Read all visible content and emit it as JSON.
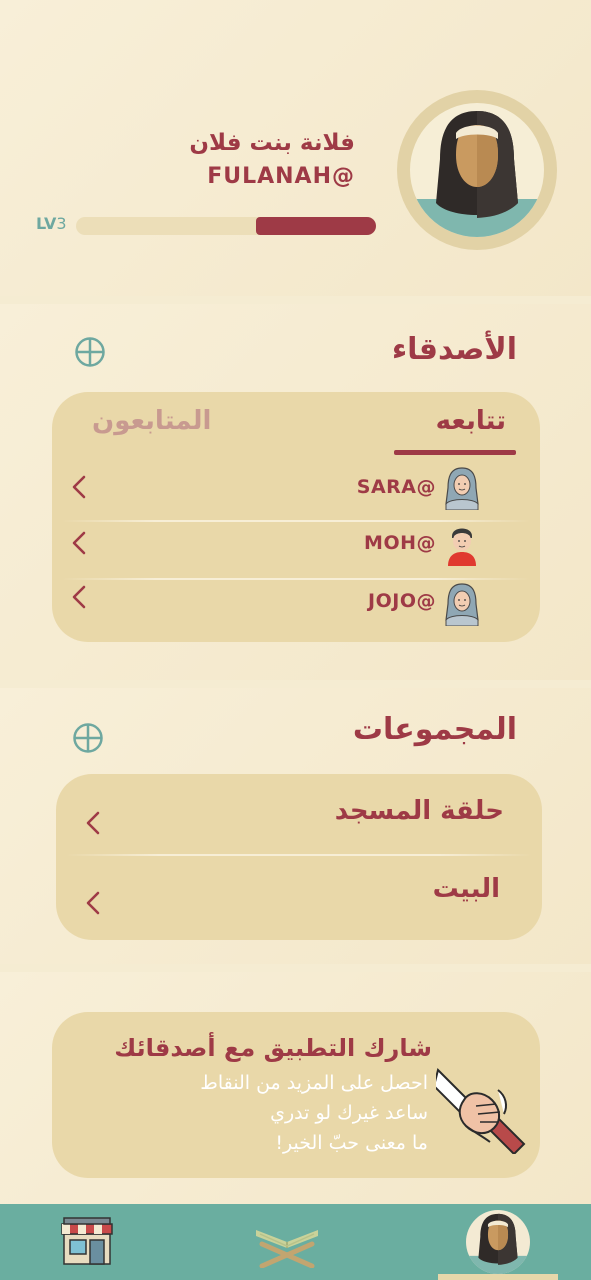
{
  "profile": {
    "name": "فلانة بنت فلان",
    "handle": "FULANAH@",
    "level_prefix": "LV",
    "level_number": "3",
    "xp_progress": 0.4
  },
  "friends": {
    "title": "الأصدقاء",
    "tabs": {
      "following": "تتابعه",
      "followers": "المتابعون"
    },
    "list": [
      {
        "handle": "SARA@",
        "avatar": "hijab-avatar-icon"
      },
      {
        "handle": "MOH@",
        "avatar": "male-avatar-icon"
      },
      {
        "handle": "JOJO@",
        "avatar": "hijab-avatar-icon"
      }
    ]
  },
  "groups": {
    "title": "المجموعات",
    "list": [
      {
        "name": "حلقة المسجد"
      },
      {
        "name": "البيت"
      }
    ]
  },
  "share": {
    "title": "شارك التطبيق مع أصدقائك",
    "line1": "احصل على المزيد من النقاط",
    "line2": "ساعد غيرك لو تدري",
    "line3": "ما معنى حبّ الخير!",
    "icon": "handshake-icon"
  },
  "nav": {
    "items": [
      "store-icon",
      "quran-icon",
      "profile-avatar-icon"
    ],
    "active": "profile-avatar-icon"
  },
  "colors": {
    "primary": "#9e3a46",
    "background": "#f5ecd2",
    "card": "#e9d8a9",
    "teal": "#6aaea0"
  }
}
